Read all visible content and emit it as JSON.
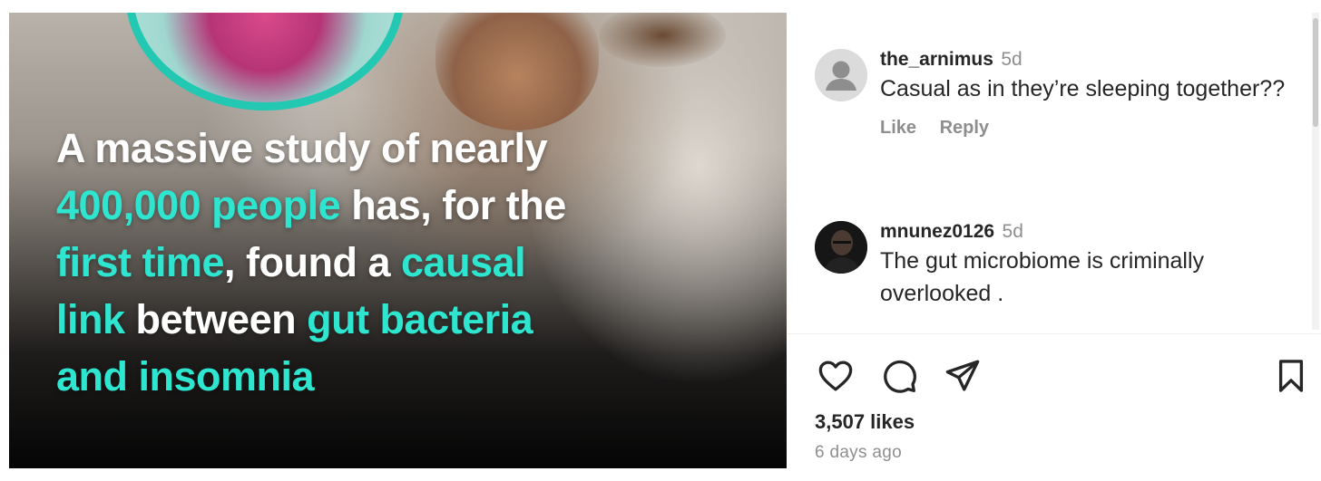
{
  "post": {
    "headline_parts": [
      {
        "text": "A massive study of nearly",
        "highlight": false
      },
      {
        "text": "400,000 people",
        "highlight": true
      },
      {
        "text": " has, for the",
        "highlight": false
      },
      {
        "text": "first time",
        "highlight": true
      },
      {
        "text": ", found a ",
        "highlight": false
      },
      {
        "text": "causal",
        "highlight": true
      },
      {
        "text": "link",
        "highlight": true
      },
      {
        "text": " between ",
        "highlight": false
      },
      {
        "text": "gut bacteria",
        "highlight": true
      },
      {
        "text": "and insomnia",
        "highlight": true
      }
    ],
    "highlight_color": "#2ee6cf"
  },
  "comments": [
    {
      "username": "the_arnimus",
      "time": "5d",
      "text": "Casual as in they’re sleeping together??",
      "like_label": "Like",
      "reply_label": "Reply",
      "avatar": "default-avatar-icon"
    },
    {
      "username": "mnunez0126",
      "time": "5d",
      "text": "The gut microbiome is criminally overlooked .",
      "avatar": "user-photo"
    }
  ],
  "actions": {
    "icons": [
      "heart-icon",
      "comment-icon",
      "share-icon",
      "bookmark-icon"
    ]
  },
  "stats": {
    "likes": "3,507 likes",
    "posted_ago": "6 days ago"
  },
  "colors": {
    "accent": "#2ee6cf",
    "text": "#262626",
    "muted": "#8e8e8e"
  }
}
